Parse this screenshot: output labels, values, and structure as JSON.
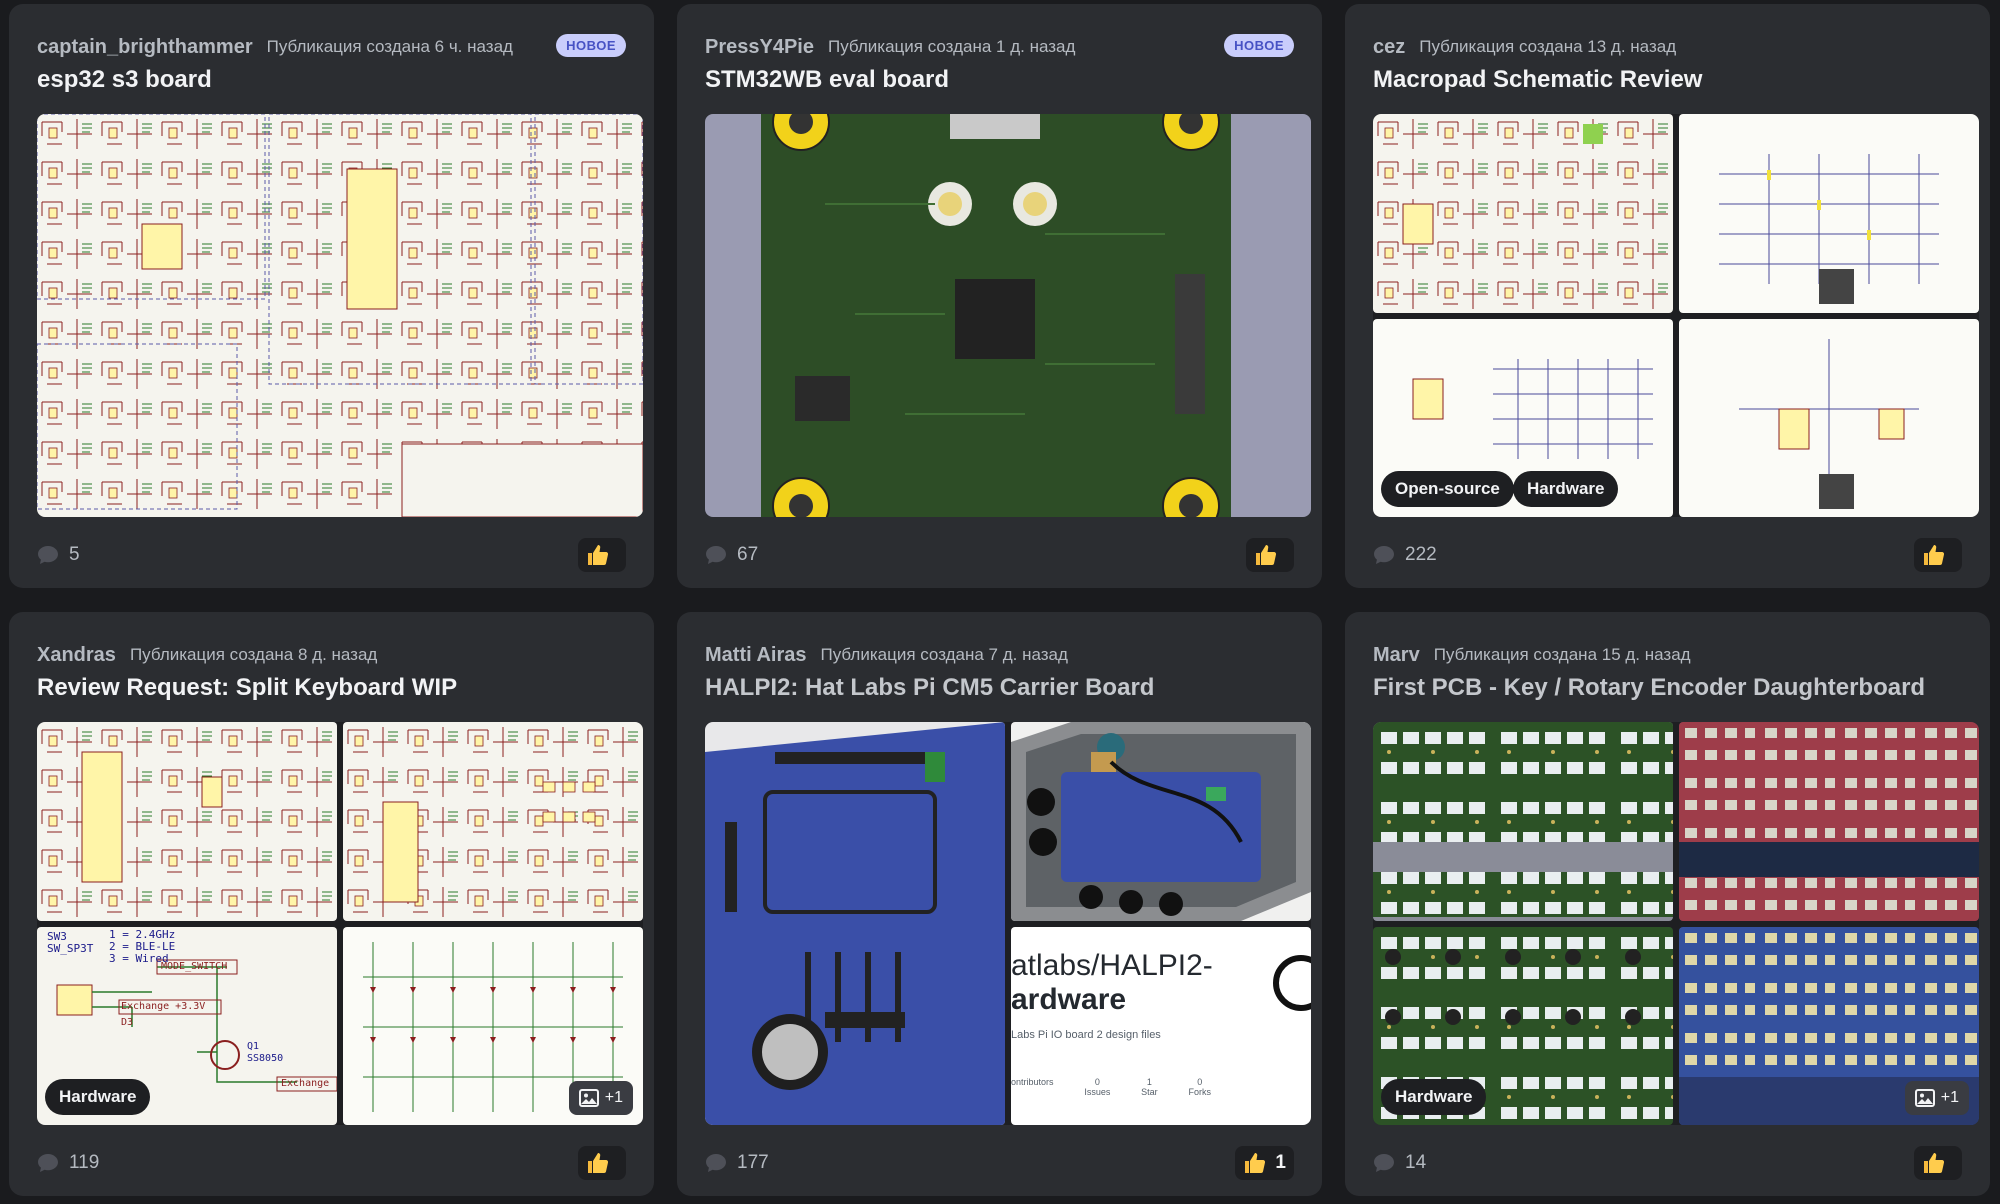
{
  "posts": [
    {
      "author": "captain_brighthammer",
      "time": "Публикация создана 6 ч. назад",
      "badge": "НОВОЕ",
      "title": "esp32 s3 board",
      "comments": "5",
      "thumb_count": ""
    },
    {
      "author": "PressY4Pie",
      "time": "Публикация создана 1 д. назад",
      "badge": "НОВОЕ",
      "title": "STM32WB eval board",
      "comments": "67",
      "thumb_count": ""
    },
    {
      "author": "cez",
      "time": "Публикация создана 13 д. назад",
      "title": "Macropad Schematic Review",
      "tags": [
        "Open-source",
        "Hardware"
      ],
      "comments": "222",
      "thumb_count": ""
    },
    {
      "author": "Xandras",
      "time": "Публикация создана 8 д. назад",
      "title": "Review Request: Split Keyboard WIP",
      "tags": [
        "Hardware"
      ],
      "more_images": "+1",
      "schematic_text": [
        "SW3",
        "SW_SP3T",
        "1 = 2.4GHz",
        "2 = BLE-LE",
        "3 = Wired",
        "MODE_SWITCH",
        "Exchange +3.3V",
        "D3",
        "Q1",
        "SS8050",
        "Exchange"
      ],
      "comments": "119",
      "thumb_count": ""
    },
    {
      "author": "Matti Airas",
      "time": "Публикация создана 7 д. назад",
      "title": "HALPI2: Hat Labs Pi CM5 Carrier Board",
      "repo": {
        "name_line1": "atlabs/HALPI2-",
        "name_line2": "ardware",
        "desc": "Labs Pi IO board 2 design files",
        "stats": [
          {
            "label": "ontributors",
            "value": ""
          },
          {
            "label": "Issues",
            "value": "0"
          },
          {
            "label": "Star",
            "value": "1"
          },
          {
            "label": "Forks",
            "value": "0"
          }
        ]
      },
      "comments": "177",
      "thumb_count": "1"
    },
    {
      "author": "Marv",
      "time": "Публикация создана 15 д. назад",
      "title": "First PCB - Key / Rotary Encoder Daughterboard",
      "tags": [
        "Hardware"
      ],
      "more_images": "+1",
      "comments": "14",
      "thumb_count": ""
    }
  ],
  "colors": {
    "bg": "#1a1b1e",
    "card": "#2b2d31",
    "badge_bg": "#c9cdfb",
    "badge_fg": "#4752c4",
    "pcb_green": "#2e5a2a",
    "pcb_blue": "#3a4fa8",
    "pcb_red": "#a8454f"
  }
}
